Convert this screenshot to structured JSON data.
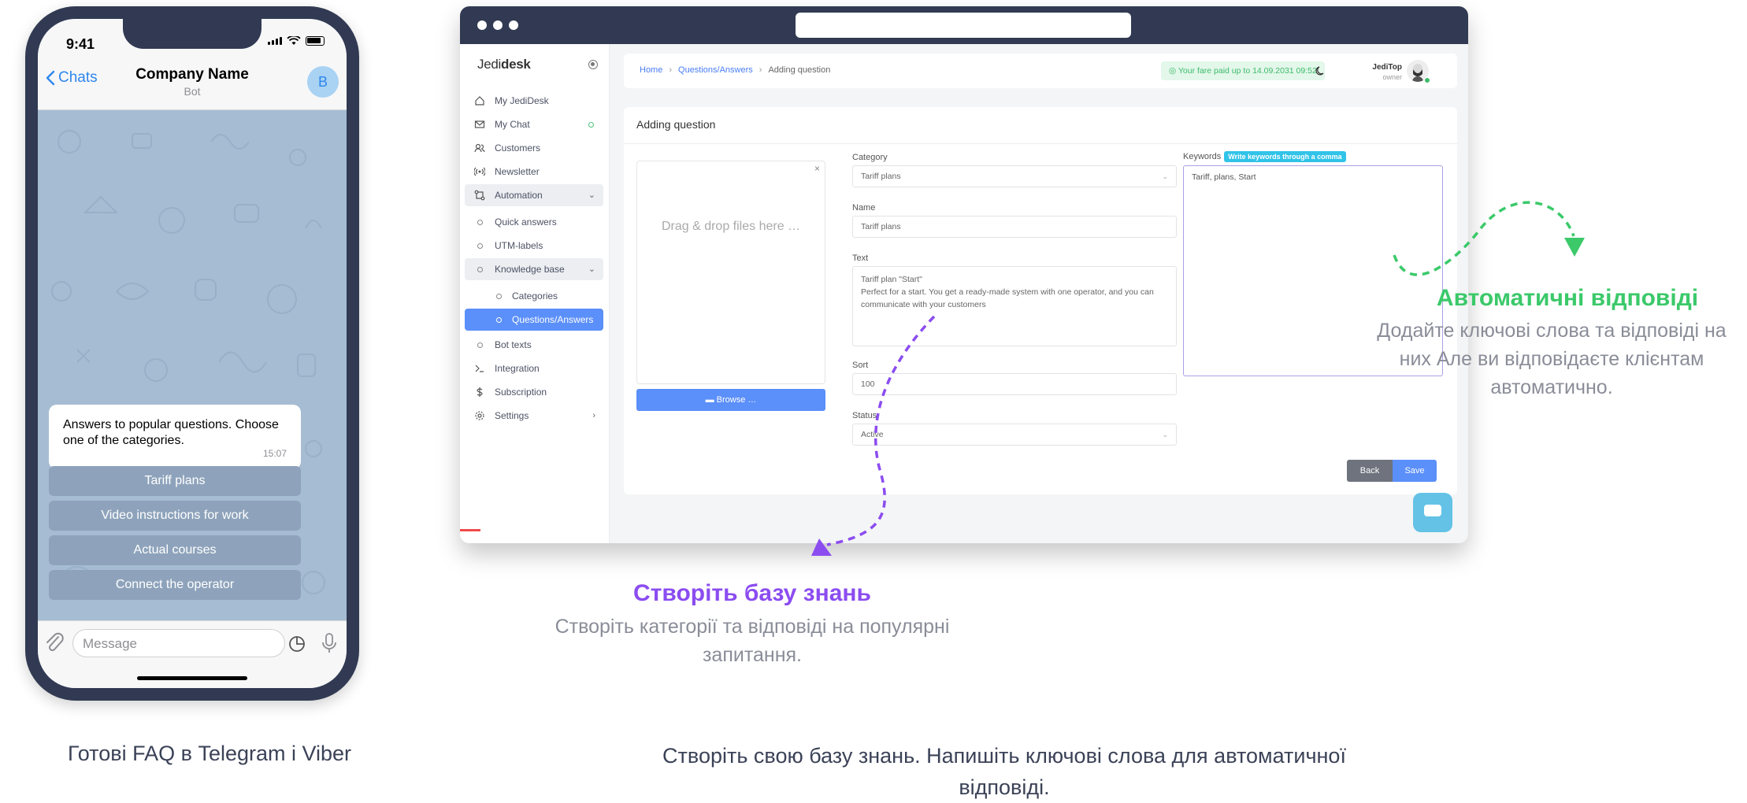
{
  "phone": {
    "status_time": "9:41",
    "back_label": "Chats",
    "chat_title": "Company Name",
    "chat_subtitle": "Bot",
    "avatar_letter": "B",
    "bot_message": "Answers to popular questions. Choose one of the categories.",
    "bot_message_time": "15:07",
    "bot_buttons": [
      "Tariff plans",
      "Video instructions for work",
      "Actual courses",
      "Connect the operator"
    ],
    "message_placeholder": "Message"
  },
  "caption_left": "Готові FAQ в Telegram і Viber",
  "app": {
    "logo_light": "Jedi",
    "logo_bold": "desk",
    "sidebar": [
      {
        "label": "My JediDesk",
        "icon": "home-icon"
      },
      {
        "label": "My Chat",
        "icon": "mail-icon"
      },
      {
        "label": "Customers",
        "icon": "users-icon"
      },
      {
        "label": "Newsletter",
        "icon": "broadcast-icon"
      },
      {
        "label": "Automation",
        "icon": "automation-icon"
      },
      {
        "label": "Quick answers"
      },
      {
        "label": "UTM-labels"
      },
      {
        "label": "Knowledge base"
      },
      {
        "label": "Categories"
      },
      {
        "label": "Questions/Answers"
      },
      {
        "label": "Bot texts"
      },
      {
        "label": "Integration",
        "icon": "terminal-icon"
      },
      {
        "label": "Subscription",
        "icon": "dollar-icon"
      },
      {
        "label": "Settings",
        "icon": "gear-icon"
      }
    ],
    "breadcrumb": {
      "home": "Home",
      "section": "Questions/Answers",
      "current": "Adding question"
    },
    "paid_notice": "Your fare paid up to 14.09.2031 09:52",
    "user_name": "JediTop",
    "user_role": "owner",
    "form": {
      "title": "Adding question",
      "dropzone_text": "Drag & drop files here …",
      "browse_label": "Browse …",
      "category_label": "Category",
      "category_value": "Tariff plans",
      "name_label": "Name",
      "name_value": "Tariff plans",
      "text_label": "Text",
      "text_value_line1": "Tariff plan \"Start\"",
      "text_value_line2": "Perfect for a start. You get a ready-made system with one operator, and you can communicate with your customers",
      "sort_label": "Sort",
      "sort_value": "100",
      "status_label": "Status",
      "status_value": "Active",
      "keywords_label": "Keywords",
      "keywords_hint": "Write keywords through a comma",
      "keywords_value": "Tariff, plans, Start",
      "back_label": "Back",
      "save_label": "Save"
    }
  },
  "annotations": {
    "purple_title": "Створіть базу знань",
    "purple_text": "Створіть категорії та відповіді на популярні запитання.",
    "green_title": "Автоматичні відповіді",
    "green_text": "Додайте ключові слова та відповіді на них Але ви відповідаєте клієнтам автоматично.",
    "purple_color": "#8b4cf0",
    "green_color": "#3bc96a"
  },
  "caption_right": "Створіть свою базу знань. Напишіть ключові слова для автоматичної відповіді."
}
